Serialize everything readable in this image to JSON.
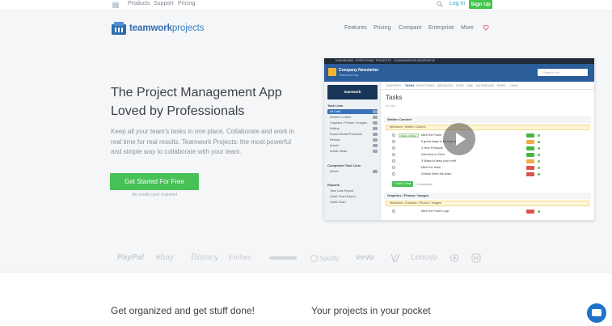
{
  "topbar": {
    "links": [
      "Products",
      "Support",
      "Pricing"
    ],
    "login": "Log In",
    "signup": "Sign Up"
  },
  "brand": {
    "prefix": "teamwork",
    "suffix": "projects"
  },
  "nav": {
    "items": [
      "Features",
      "Pricing",
      "Compare",
      "Enterprise",
      "More"
    ]
  },
  "hero": {
    "title_line1": "The Project Management App",
    "title_line2": "Loved by Professionals",
    "text": "Keep all your team's tasks in one place. Collaborate and work in real time for real results. Teamwork Projects: the most powerful and simple way to collaborate with your team.",
    "cta": "Get Started For Free",
    "cta_note": "No credit card required"
  },
  "mock": {
    "topnav": [
      "DASHBOARD",
      "EVERYTHING",
      "PROJECTS",
      "CALENDAR",
      "STATUSES",
      "PEOPLE"
    ],
    "project_name": "Company Newsletter",
    "project_company": "Teamwork Corp",
    "search": "Search For",
    "tabs": [
      "OVERVIEW",
      "TASKS",
      "MILESTONES",
      "MESSAGES",
      "FILES",
      "TIME",
      "NOTEBOOKS",
      "RISKS",
      "LINKS"
    ],
    "title": "Tasks",
    "subtitle": "All Lists",
    "sidebar_logo": "teamwork",
    "task_lists_head": "Task Lists",
    "sidebar_items": [
      "All Lists",
      "Written Content",
      "Graphics / Photos / Images",
      "Editing",
      "Social Media Promotion",
      "Review",
      "Admin",
      "Article Ideas"
    ],
    "completed_head": "Completed Task Lists",
    "completed_items": [
      "Admin"
    ],
    "reports_head": "Reports",
    "reports_items": [
      "Task Lists Report",
      "Gantt Chart Export",
      "Gantt Chart"
    ],
    "list1": "Written Content",
    "milestone1": "Milestone: Written Content",
    "tasks": [
      {
        "who": "Ryan +1 More",
        "text": "Meet the Team"
      },
      {
        "who": "",
        "text": "5 great ways to be more pro"
      },
      {
        "who": "",
        "text": "3 New Products"
      },
      {
        "who": "",
        "text": "Interview a Client"
      },
      {
        "who": "",
        "text": "3 Ways to keep your brief"
      },
      {
        "who": "",
        "text": "Meet the team"
      },
      {
        "who": "",
        "text": "Default Meet the team"
      }
    ],
    "add_task": "+ Add a Task",
    "add_note": "4 Completed",
    "list2": "Graphics / Photos / Images",
    "milestone2": "Milestone: Graphics / Photos / Images",
    "task2": "Meet the Team Logo"
  },
  "partners": [
    "PayPal",
    "ebay",
    "Disney",
    "Forbes",
    "Spotify",
    "vevo",
    "Lenovo"
  ],
  "bottom": {
    "left": "Get organized and get stuff done!",
    "right": "Your projects in your pocket"
  },
  "colors": {
    "accent": "#48c157",
    "brand": "#2f6bb0"
  }
}
